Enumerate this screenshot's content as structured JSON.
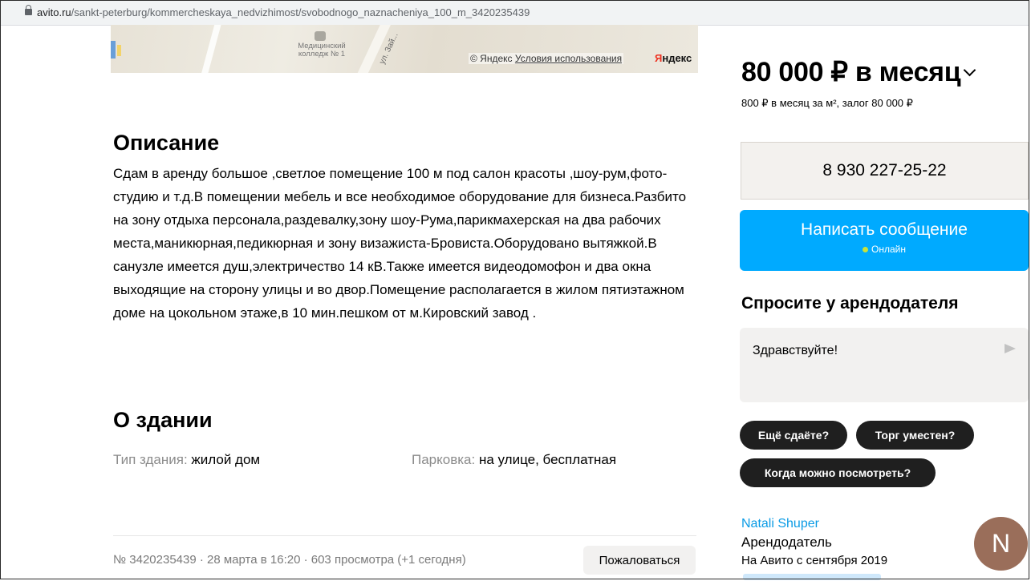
{
  "browser": {
    "url_domain": "avito.ru",
    "url_path": "/sankt-peterburg/kommercheskaya_nedvizhimost/svobodnogo_naznacheniya_100_m_3420235439"
  },
  "map": {
    "poi_label": "Медицинский колледж № 1",
    "street_label": "ул. Зай...",
    "copyright": "© Яндекс",
    "terms_link": "Условия использования",
    "logo": "Яндекс"
  },
  "description": {
    "heading": "Описание",
    "text": "Сдам в аренду большое ,светлое помещение 100 м под салон красоты ,шоу-рум,фото-студию и т.д.В помещении мебель и все необходимое оборудование для бизнеса.Разбито на зону отдыха персонала,раздевалку,зону шоу-Рума,парикмахерская на два рабочих места,маникюрная,педикюрная и зону визажиста-Бровиста.Оборудовано вытяжкой.В санузле имеется душ,электричество 14 кВ.Также имеется видеодомофон и два окна выходящие на сторону улицы и во двор.Помещение располагается в жилом пятиэтажном доме на цокольном этаже,в 10 мин.пешком от м.Кировский завод ."
  },
  "building": {
    "heading": "О здании",
    "type_label": "Тип здания:",
    "type_value": "жилой дом",
    "parking_label": "Парковка:",
    "parking_value": "на улице, бесплатная"
  },
  "footer": {
    "meta": "№ 3420235439 · 28 марта в 16:20 · 603 просмотра (+1 сегодня)",
    "report_label": "Пожаловаться"
  },
  "sidebar": {
    "price": "80 000 ₽ в месяц",
    "price_sub": "800 ₽ в месяц за м², залог 80 000 ₽",
    "phone": "8 930 227-25-22",
    "message_button": "Написать сообщение",
    "online_status": "Онлайн",
    "ask_heading": "Спросите у арендодателя",
    "ask_value": "Здравствуйте!",
    "chips": [
      "Ещё сдаёте?",
      "Торг уместен?",
      "Когда можно посмотреть?"
    ],
    "seller_name": "Natali Shuper",
    "seller_role": "Арендодатель",
    "seller_since": "На Авито с сентября 2019",
    "avatar_letter": "N"
  },
  "colors": {
    "accent": "#00aaff",
    "link": "#0a9be5",
    "chip": "#1f1f1f",
    "avatar": "#9a6e5a",
    "online_dot": "#c8e23a"
  },
  "icons": [
    "lock-icon",
    "chevron-down-icon",
    "send-icon",
    "online-dot-icon"
  ]
}
